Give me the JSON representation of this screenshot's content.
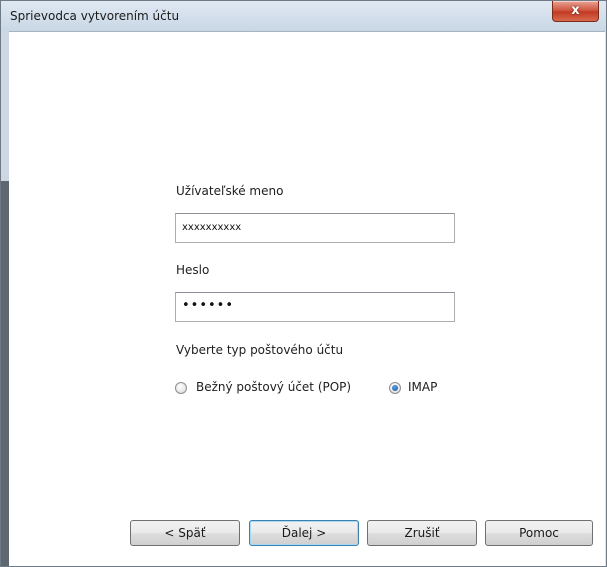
{
  "window": {
    "title": "Sprievodca vytvorením účtu",
    "close_label": "x"
  },
  "form": {
    "username": {
      "label": "Užívateľské meno",
      "value": "xxxxxxxxxx"
    },
    "password": {
      "label": "Heslo",
      "value": "••••••"
    },
    "account_type": {
      "label": "Vyberte typ poštového účtu",
      "options": [
        {
          "label": "Bežný poštový účet (POP)",
          "selected": false
        },
        {
          "label": "IMAP",
          "selected": true
        }
      ]
    }
  },
  "buttons": {
    "back": "< Späť",
    "next": "Ďalej >",
    "cancel": "Zrušiť",
    "help": "Pomoc"
  }
}
